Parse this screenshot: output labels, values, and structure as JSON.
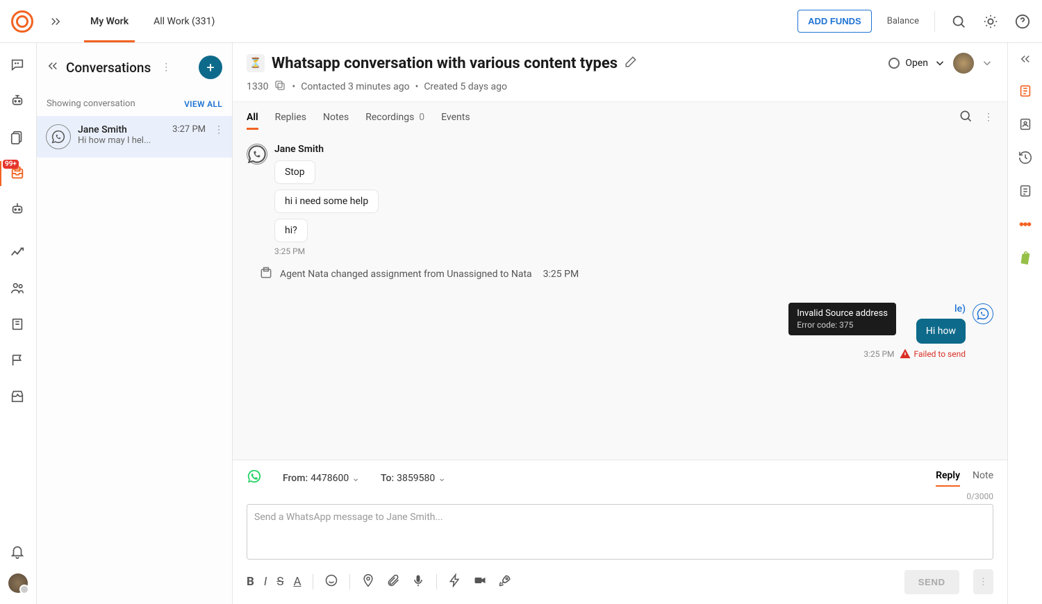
{
  "topbar": {
    "tabs": {
      "myWork": "My Work",
      "allWork": "All Work (331)"
    },
    "addFunds": "ADD FUNDS",
    "balance": "Balance"
  },
  "leftbar": {
    "badge": "99+"
  },
  "conversations": {
    "title": "Conversations",
    "showing": "Showing conversation",
    "viewAll": "VIEW ALL",
    "item": {
      "name": "Jane Smith",
      "preview": "Hi how may I hel...",
      "time": "3:27 PM"
    }
  },
  "header": {
    "title": "Whatsapp conversation with various content types",
    "id": "1330",
    "contacted": "Contacted 3 minutes ago",
    "created": "Created 5 days ago",
    "status": "Open"
  },
  "feedtabs": {
    "all": "All",
    "replies": "Replies",
    "notes": "Notes",
    "recordings": "Recordings",
    "recCount": "0",
    "events": "Events"
  },
  "feed": {
    "sender": "Jane Smith",
    "msgs": [
      "Stop",
      "hi i need some help",
      "hi?"
    ],
    "incomingTime": "3:25 PM",
    "systemEvent": "Agent Nata changed assignment from Unassigned to Nata",
    "systemTime": "3:25 PM",
    "outgoing": {
      "senderSuffix": "le)",
      "text": "Hi how",
      "time": "3:25 PM",
      "failLabel": "Failed to send"
    },
    "tooltip": {
      "line1": "Invalid Source address",
      "line2": "Error code: 375"
    }
  },
  "composer": {
    "fromLabel": "From:",
    "fromValue": "4478600",
    "toLabel": "To:",
    "toValue": "3859580",
    "replyTab": "Reply",
    "noteTab": "Note",
    "charCount": "0/3000",
    "placeholder": "Send a WhatsApp message to Jane Smith...",
    "send": "SEND"
  }
}
